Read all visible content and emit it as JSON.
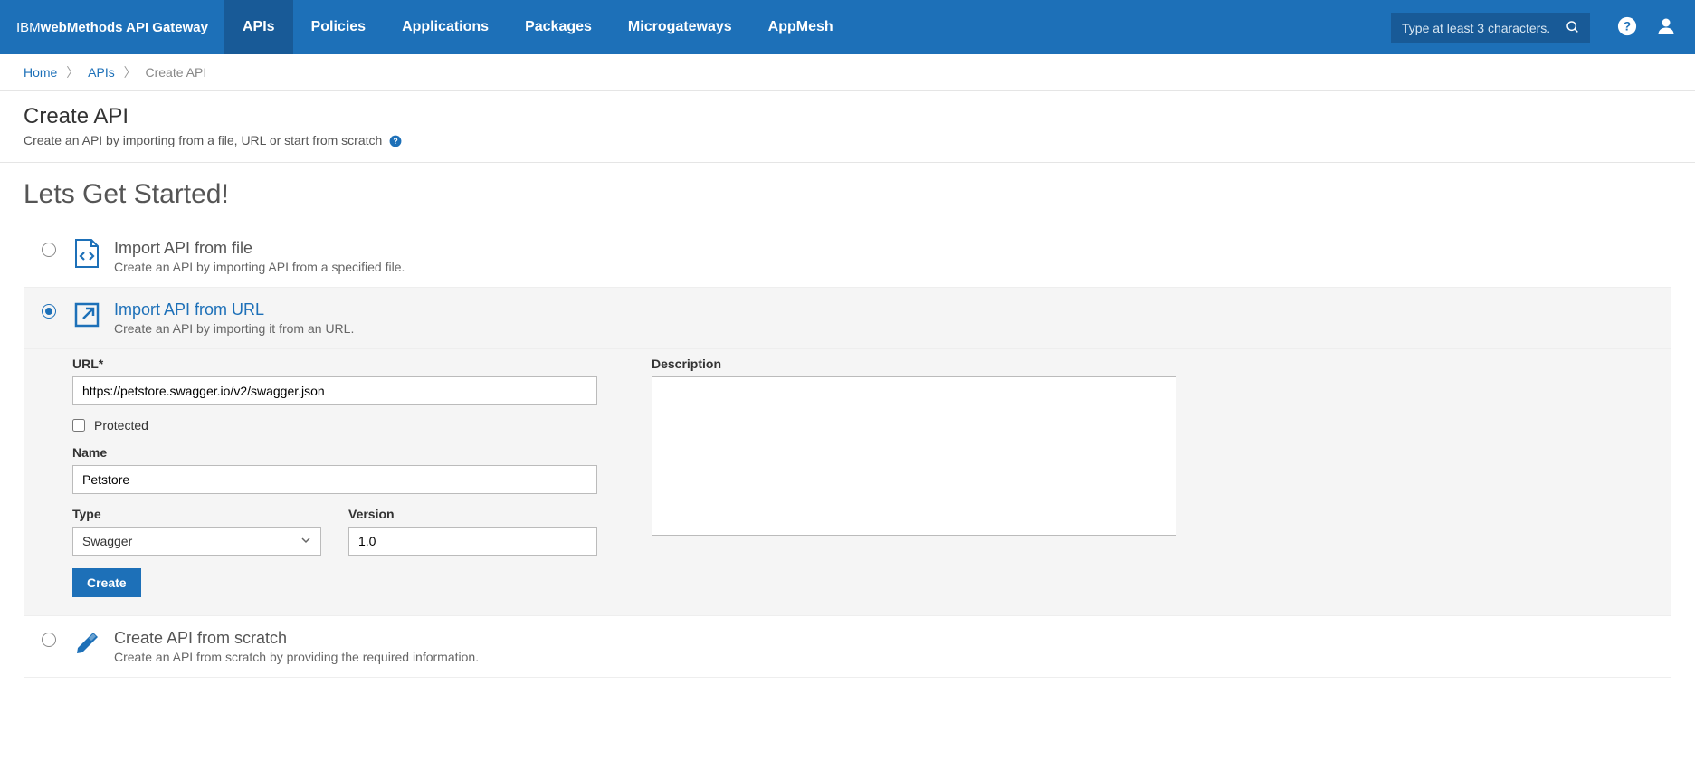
{
  "brand": {
    "prefix": "IBM ",
    "bold": "webMethods API Gateway"
  },
  "nav": {
    "tabs": [
      "APIs",
      "Policies",
      "Applications",
      "Packages",
      "Microgateways",
      "AppMesh"
    ],
    "active_index": 0,
    "search_placeholder": "Type at least 3 characters."
  },
  "breadcrumb": {
    "items": [
      "Home",
      "APIs"
    ],
    "current": "Create API"
  },
  "page": {
    "title": "Create API",
    "subtitle": "Create an API by importing from a file, URL or start from scratch"
  },
  "main": {
    "heading": "Lets Get Started!",
    "options": [
      {
        "title": "Import API from file",
        "desc": "Create an API by importing API from a specified file."
      },
      {
        "title": "Import API from URL",
        "desc": "Create an API by importing it from an URL."
      },
      {
        "title": "Create API from scratch",
        "desc": "Create an API from scratch by providing the required information."
      }
    ],
    "selected_index": 1
  },
  "form": {
    "url_label": "URL*",
    "url_value": "https://petstore.swagger.io/v2/swagger.json",
    "protected_label": "Protected",
    "protected_checked": false,
    "name_label": "Name",
    "name_value": "Petstore",
    "type_label": "Type",
    "type_value": "Swagger",
    "version_label": "Version",
    "version_value": "1.0",
    "description_label": "Description",
    "description_value": "",
    "create_button": "Create"
  }
}
